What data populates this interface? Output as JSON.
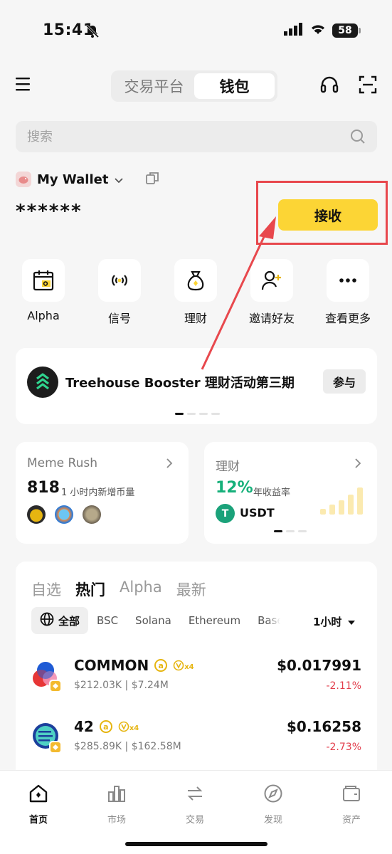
{
  "status_bar": {
    "time": "15:41",
    "battery": "58"
  },
  "header": {
    "tabs": [
      {
        "label": "交易平台"
      },
      {
        "label": "钱包"
      }
    ]
  },
  "search": {
    "placeholder": "搜索"
  },
  "wallet": {
    "name": "My Wallet",
    "balance": "******",
    "receive_label": "接收"
  },
  "shortcuts": [
    {
      "label": "Alpha",
      "icon": "calendar-alpha-icon"
    },
    {
      "label": "信号",
      "icon": "signal-broadcast-icon"
    },
    {
      "label": "理财",
      "icon": "money-bag-icon"
    },
    {
      "label": "邀请好友",
      "icon": "invite-user-icon"
    },
    {
      "label": "查看更多",
      "icon": "more-icon"
    }
  ],
  "banner": {
    "text": "Treehouse Booster 理财活动第三期",
    "button": "参与"
  },
  "meme_card": {
    "title": "Meme Rush",
    "count": "818",
    "subtitle": "1 小时内新增币量"
  },
  "earn_card": {
    "title": "理财",
    "apy": "12%",
    "apy_label": "年收益率",
    "asset": "USDT",
    "asset_logo": "T"
  },
  "market": {
    "tabs": [
      {
        "label": "自选"
      },
      {
        "label": "热门"
      },
      {
        "label": "Alpha"
      },
      {
        "label": "最新"
      }
    ],
    "chains": [
      {
        "label": "全部"
      },
      {
        "label": "BSC"
      },
      {
        "label": "Solana"
      },
      {
        "label": "Ethereum"
      },
      {
        "label": "Base"
      }
    ],
    "time_filter": "1小时",
    "rows": [
      {
        "name": "COMMON",
        "volume": "$212.03K",
        "market_cap": "$7.24M",
        "price": "$0.017991",
        "change": "-2.11%",
        "multiplier": "x4"
      },
      {
        "name": "42",
        "volume": "$285.89K",
        "market_cap": "$162.58M",
        "price": "$0.16258",
        "change": "-2.73%",
        "multiplier": "x4"
      }
    ]
  },
  "tabbar": [
    {
      "label": "首页"
    },
    {
      "label": "市场"
    },
    {
      "label": "交易"
    },
    {
      "label": "发现"
    },
    {
      "label": "资产"
    }
  ],
  "colors": {
    "accent": "#fcd535",
    "highlight": "#e8484d",
    "positive": "#16b07a",
    "negative": "#e23d4b"
  }
}
